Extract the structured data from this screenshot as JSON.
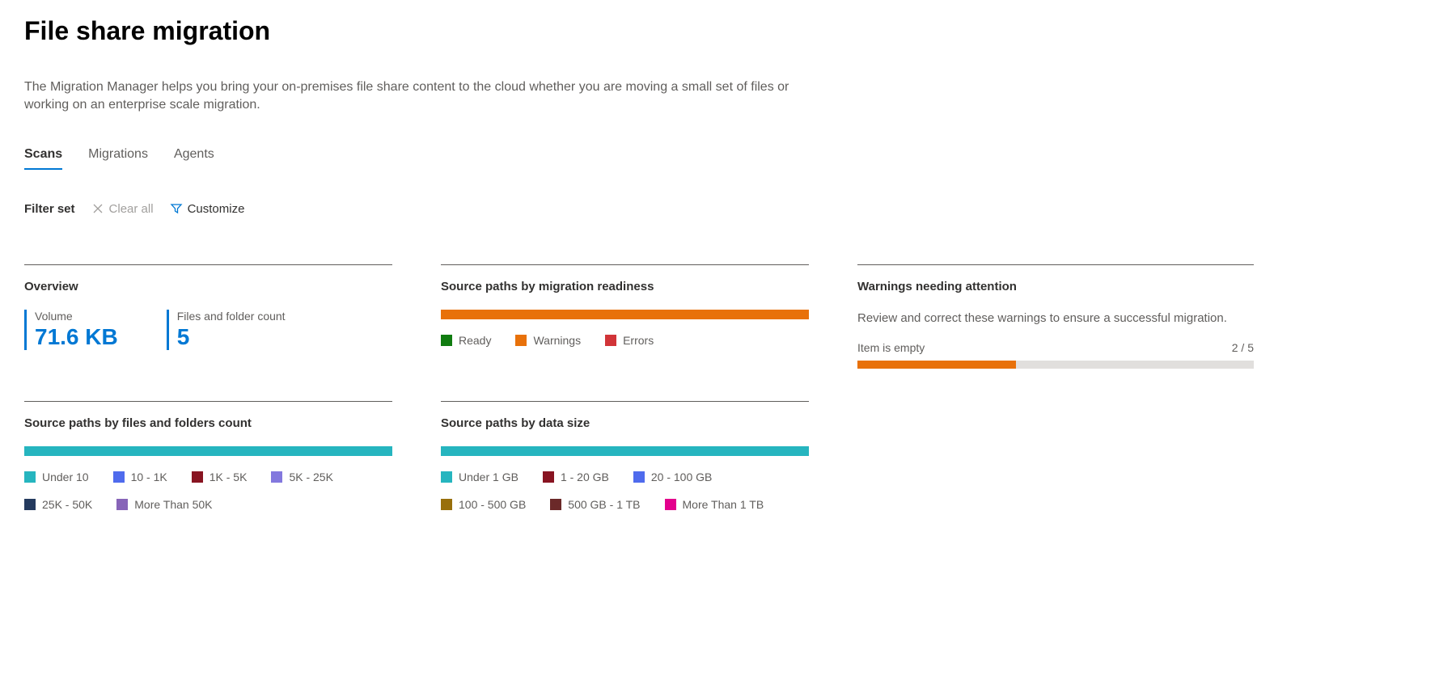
{
  "page": {
    "title": "File share migration",
    "description": "The Migration Manager helps you bring your on-premises file share content to the cloud whether you are moving a small set of files or working on an enterprise scale migration."
  },
  "tabs": {
    "scans": "Scans",
    "migrations": "Migrations",
    "agents": "Agents"
  },
  "filter": {
    "label": "Filter set",
    "clear_all": "Clear all",
    "customize": "Customize"
  },
  "overview": {
    "title": "Overview",
    "volume_label": "Volume",
    "volume_value": "71.6 KB",
    "count_label": "Files and folder count",
    "count_value": "5"
  },
  "readiness": {
    "title": "Source paths by migration readiness",
    "legend": {
      "ready": "Ready",
      "warnings": "Warnings",
      "errors": "Errors"
    }
  },
  "warnings_panel": {
    "title": "Warnings needing attention",
    "subtext": "Review and correct these warnings to ensure a successful migration.",
    "item_label": "Item is empty",
    "progress_text": "2 / 5"
  },
  "paths_by_count": {
    "title": "Source paths by files and folders count",
    "legend": {
      "under10": "Under 10",
      "r10_1k": "10 - 1K",
      "r1k_5k": "1K - 5K",
      "r5k_25k": "5K - 25K",
      "r25k_50k": "25K - 50K",
      "more50k": "More Than 50K"
    }
  },
  "paths_by_size": {
    "title": "Source paths by data size",
    "legend": {
      "under1gb": "Under 1 GB",
      "r1_20": "1 - 20 GB",
      "r20_100": "20 - 100 GB",
      "r100_500": "100 - 500 GB",
      "r500_1tb": "500 GB - 1 TB",
      "more1tb": "More Than 1 TB"
    }
  },
  "colors": {
    "teal": "#26b5bf",
    "green": "#107c10",
    "orange": "#e8710a",
    "red": "#d13438",
    "indigo": "#4f6bed",
    "maroon": "#881798",
    "lavender": "#8378de",
    "navy": "#243a5e",
    "purple": "#8764b8",
    "darkred": "#881421",
    "pink": "#e3008c",
    "olive": "#986f0b",
    "plum": "#6b2929"
  },
  "chart_data": [
    {
      "type": "bar",
      "title": "Source paths by migration readiness",
      "categories": [
        "Ready",
        "Warnings",
        "Errors"
      ],
      "values": [
        0,
        5,
        0
      ],
      "colors": [
        "#107c10",
        "#e8710a",
        "#d13438"
      ]
    },
    {
      "type": "bar",
      "title": "Source paths by files and folders count",
      "categories": [
        "Under 10",
        "10 - 1K",
        "1K - 5K",
        "5K - 25K",
        "25K - 50K",
        "More Than 50K"
      ],
      "values": [
        5,
        0,
        0,
        0,
        0,
        0
      ],
      "colors": [
        "#26b5bf",
        "#4f6bed",
        "#881421",
        "#8378de",
        "#243a5e",
        "#8764b8"
      ]
    },
    {
      "type": "bar",
      "title": "Source paths by data size",
      "categories": [
        "Under 1 GB",
        "1 - 20 GB",
        "20 - 100 GB",
        "100 - 500 GB",
        "500 GB - 1 TB",
        "More Than 1 TB"
      ],
      "values": [
        5,
        0,
        0,
        0,
        0,
        0
      ],
      "colors": [
        "#26b5bf",
        "#881421",
        "#4f6bed",
        "#986f0b",
        "#6b2929",
        "#e3008c"
      ]
    },
    {
      "type": "bar",
      "title": "Warnings needing attention — Item is empty",
      "categories": [
        "Item is empty"
      ],
      "values": [
        2
      ],
      "total": 5,
      "ylim": [
        0,
        5
      ]
    }
  ]
}
